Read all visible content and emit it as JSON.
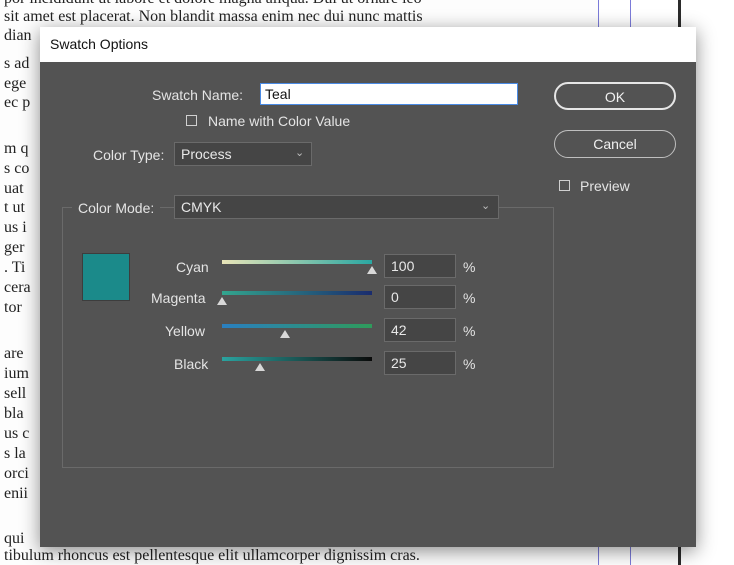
{
  "document": {
    "lines": [
      "por incididunt ut labore et dolore magna aliqua. Dui ut ornare leo",
      "sit amet est placerat. Non blandit massa enim nec dui nunc mattis",
      "dian",
      "s ad",
      "ege",
      "ec p",
      "m q",
      "s co",
      "uat",
      "t ut",
      "us i",
      "ger",
      ". Ti",
      "cera",
      "tor",
      "are",
      "ium",
      "sell",
      " bla",
      "us c",
      "s la",
      "orci",
      "enii",
      " qui",
      "tibulum rhoncus est pellentesque elit ullamcorper dignissim cras."
    ]
  },
  "dialog": {
    "title": "Swatch Options",
    "swatch_name_label": "Swatch Name:",
    "swatch_name_value": "Teal",
    "name_with_color_value_label": "Name with Color Value",
    "name_with_color_value_checked": false,
    "color_type_label": "Color Type:",
    "color_type_value": "Process",
    "color_mode_label": "Color Mode:",
    "color_mode_value": "CMYK",
    "swatch_color": "#1b8a8a",
    "channels": [
      {
        "label": "Cyan",
        "value": "100",
        "unit": "%",
        "fraction": 1.0
      },
      {
        "label": "Magenta",
        "value": "0",
        "unit": "%",
        "fraction": 0.0
      },
      {
        "label": "Yellow",
        "value": "42",
        "unit": "%",
        "fraction": 0.42
      },
      {
        "label": "Black",
        "value": "25",
        "unit": "%",
        "fraction": 0.25
      }
    ],
    "buttons": {
      "ok": "OK",
      "cancel": "Cancel"
    },
    "preview_label": "Preview",
    "preview_checked": false,
    "icons": {
      "dropdown": "chevron-down-icon"
    }
  }
}
